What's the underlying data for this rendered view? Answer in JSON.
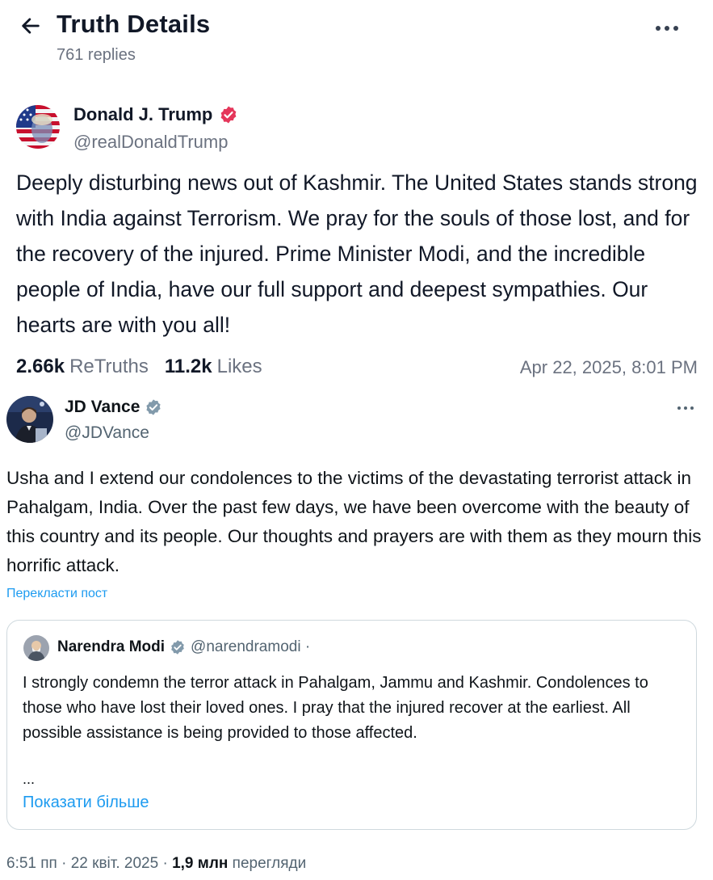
{
  "header": {
    "title": "Truth Details",
    "replies": "761 replies"
  },
  "truth_post": {
    "author_name": "Donald J. Trump",
    "handle": "@realDonaldTrump",
    "text": "Deeply disturbing news out of Kashmir. The United States stands strong with India against Terrorism. We pray for the souls of those lost, and for the recovery of the injured. Prime Minister Modi, and the incredible people of India, have our full support and deepest sympathies. Our hearts are with you all!",
    "retruths_count": "2.66k",
    "retruths_label": "ReTruths",
    "likes_count": "11.2k",
    "likes_label": "Likes",
    "timestamp": "Apr 22, 2025, 8:01 PM",
    "verified_color": "#e5365a"
  },
  "x_post": {
    "author_name": "JD Vance",
    "handle": "@JDVance",
    "text": "Usha and I extend our condolences to the victims of the devastating terrorist attack in Pahalgam, India. Over the past few days, we have been overcome with the beauty of this country and its people. Our thoughts and prayers are with them as they mourn this horrific attack.",
    "translate_link": "Перекласти пост",
    "verified_color": "#829aab",
    "quote": {
      "author_name": "Narendra Modi",
      "handle": "@narendramodi ·",
      "text": "I strongly condemn the terror attack in Pahalgam, Jammu and Kashmir. Condolences to those who have lost their loved ones. I pray that the injured recover at the earliest. All possible assistance is being provided to those affected.",
      "ellipsis": "...",
      "show_more": "Показати більше"
    },
    "meta": {
      "time_date": "6:51 пп · 22 квіт. 2025 ·",
      "views_count": "1,9 млн",
      "views_label": "перегляди"
    }
  },
  "colors": {
    "link": "#1d9bf0",
    "secondary_text": "#6b7280"
  }
}
